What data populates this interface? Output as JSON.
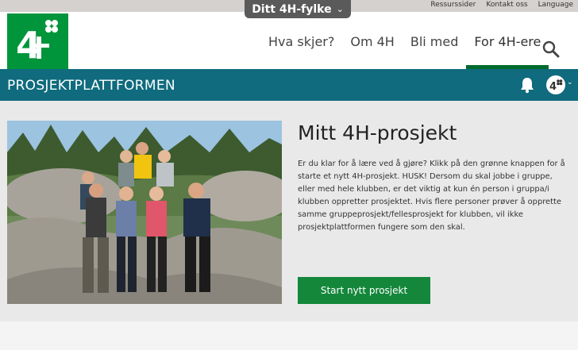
{
  "topbar": {
    "county_label": "Ditt 4H-fylke",
    "links": [
      "Ressurssider",
      "Kontakt oss",
      "Language"
    ]
  },
  "header": {
    "logo_text": "4H",
    "nav": [
      {
        "label": "Hva skjer?"
      },
      {
        "label": "Om 4H"
      },
      {
        "label": "Bli med"
      },
      {
        "label": "For 4H-ere",
        "active": true
      }
    ]
  },
  "platform": {
    "title": "PROSJEKTPLATTFORMEN"
  },
  "project": {
    "heading": "Mitt 4H-prosjekt",
    "body": "Er du klar for å lære ved å gjøre? Klikk på den grønne knappen for å starte et nytt 4H-prosjekt. HUSK! Dersom du skal jobbe i gruppe, eller med hele klubben, er det viktig at kun én person i gruppa/i klubben oppretter prosjektet. Hvis flere personer prøver å opprette samme gruppeprosjekt/fellesprosjekt for klubben, vil ikke prosjektplattformen fungere som den skal.",
    "button": "Start nytt prosjekt"
  },
  "colors": {
    "brand_green": "#00953b",
    "platform_teal": "#0f6b7d",
    "button_green": "#14873b",
    "nav_active_underline": "#006b2d"
  }
}
